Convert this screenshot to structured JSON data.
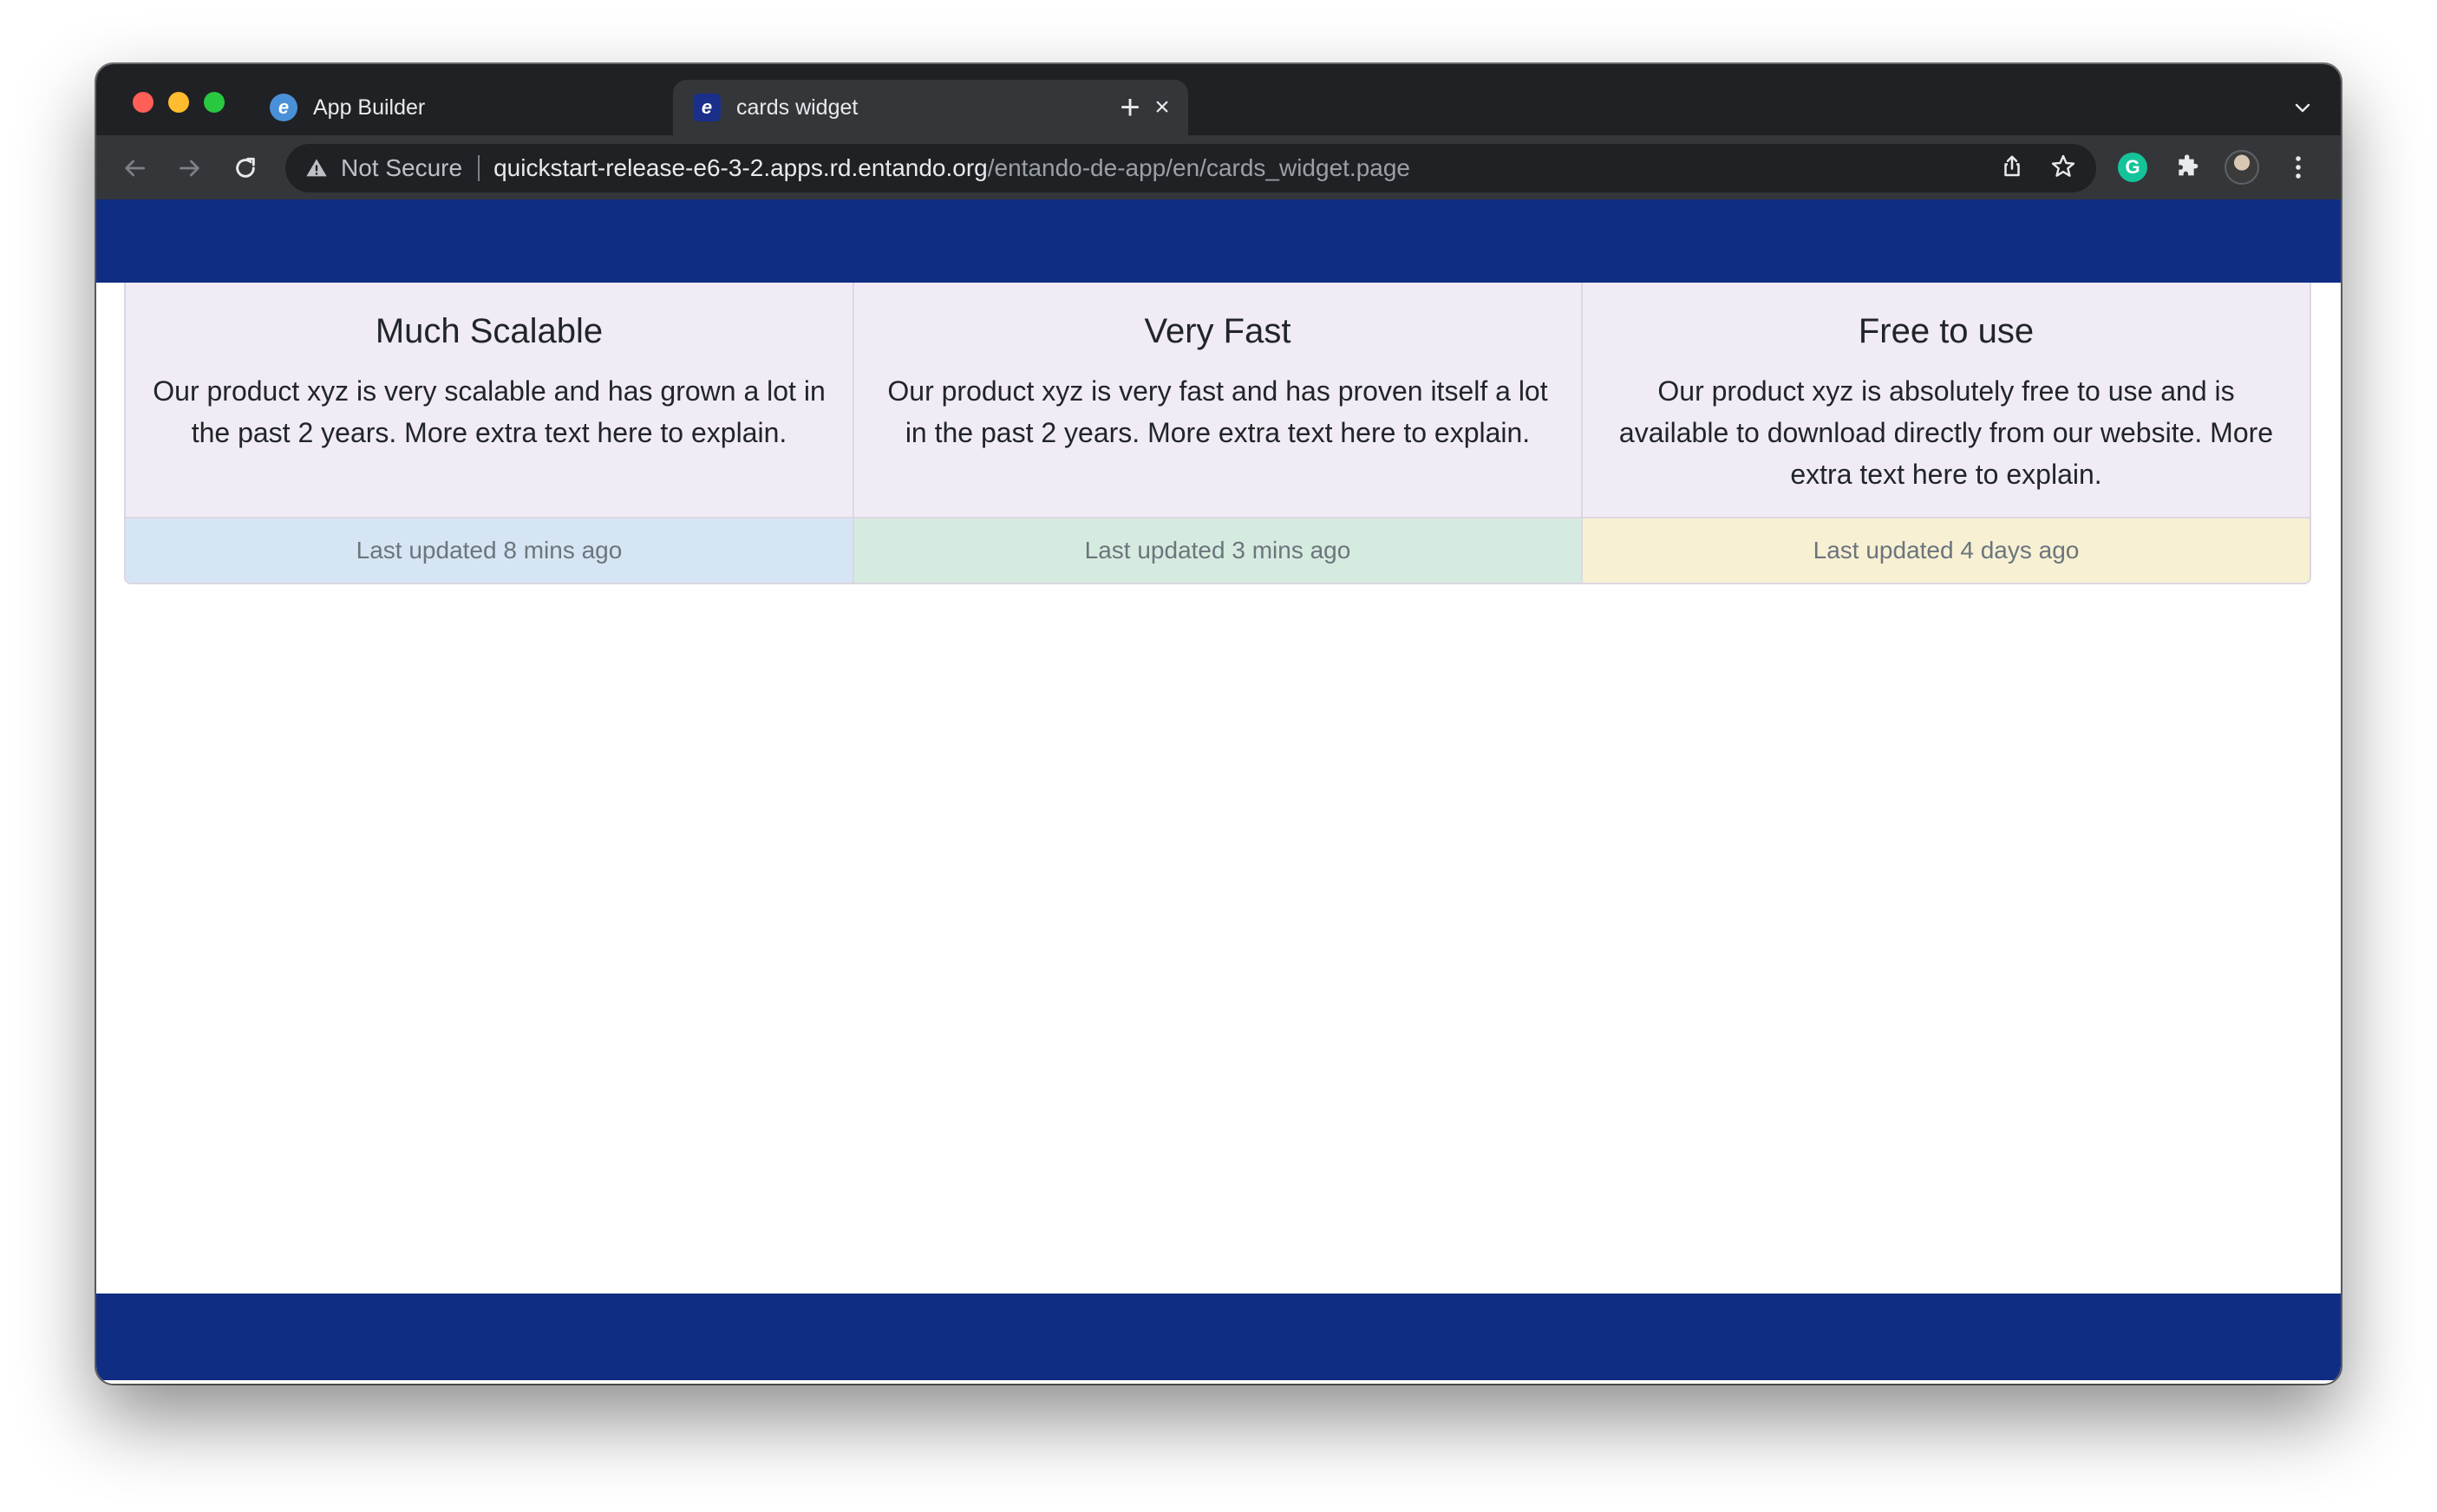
{
  "browser": {
    "tabs": [
      {
        "label": "App Builder",
        "active": false
      },
      {
        "label": "cards widget",
        "active": true
      }
    ],
    "new_tab_label": "+",
    "address": {
      "security_label": "Not Secure",
      "host": "quickstart-release-e6-3-2.apps.rd.entando.org",
      "path": "/entando-de-app/en/cards_widget.page"
    }
  },
  "cards": [
    {
      "title": "Much Scalable",
      "text": "Our product xyz is very scalable and has grown a lot in the past 2 years. More extra text here to explain.",
      "footer": "Last updated 8 mins ago"
    },
    {
      "title": "Very Fast",
      "text": "Our product xyz is very fast and has proven itself a lot in the past 2 years. More extra text here to explain.",
      "footer": "Last updated 3 mins ago"
    },
    {
      "title": "Free to use",
      "text": "Our product xyz is absolutely free to use and is available to download directly from our website. More extra text here to explain.",
      "footer": "Last updated 4 days ago"
    }
  ],
  "colors": {
    "brand_band": "#0f2d82",
    "card_body": "#f1ebf5",
    "footer_blue": "#d6e5f3",
    "footer_green": "#d6ebdf",
    "footer_yellow": "#f7f0d3"
  },
  "icons": {
    "tab1_favicon": "entando-icon",
    "tab2_favicon": "entando-icon",
    "tab_close": "close-icon",
    "back": "arrow-left-icon",
    "forward": "arrow-right-icon",
    "reload": "reload-icon",
    "warning": "warning-icon",
    "share": "share-icon",
    "bookmark": "star-icon",
    "grammarly": "grammarly-icon",
    "extensions": "puzzle-icon",
    "menu": "kebab-menu-icon"
  }
}
